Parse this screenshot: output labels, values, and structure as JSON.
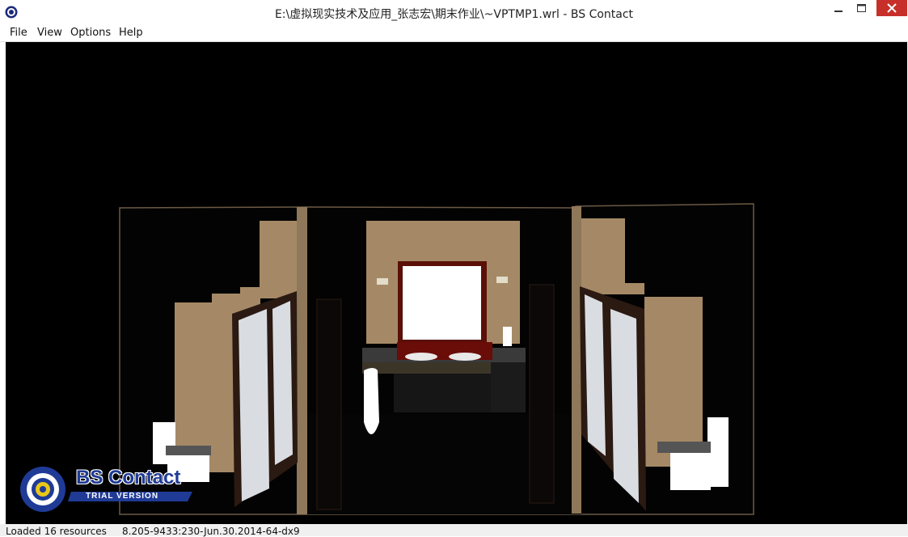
{
  "window": {
    "title": "E:\\虚拟现实技术及应用_张志宏\\期末作业\\~VPTMP1.wrl - BS Contact",
    "controls": {
      "minimize": "minimize",
      "maximize": "maximize",
      "close": "close"
    }
  },
  "menu": {
    "items": [
      "File",
      "View",
      "Options",
      "Help"
    ]
  },
  "logo": {
    "brand": "BS Contact",
    "tag": "TRIAL VERSION"
  },
  "status": {
    "left": "Loaded 16 resources",
    "right": "8.205-9433:230-Jun.30.2014-64-dx9"
  },
  "colors": {
    "close_button": "#c7302a",
    "viewport_bg": "#000000",
    "wall_beige": "#a88b68",
    "logo_blue": "#1f3b96"
  }
}
